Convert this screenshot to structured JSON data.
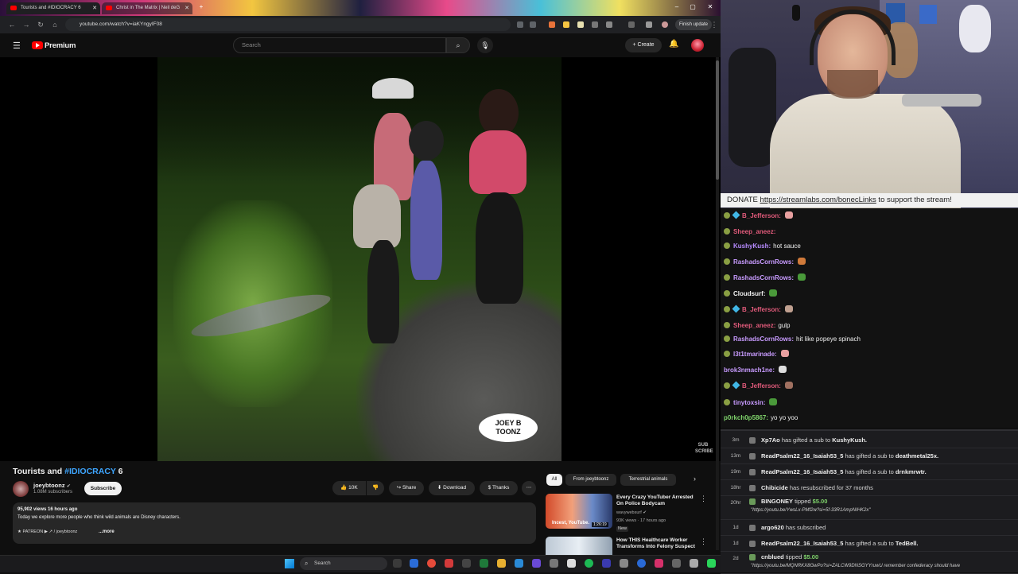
{
  "browser": {
    "tabs": [
      {
        "label": "Tourists and #IDIOCRACY 6"
      },
      {
        "label": "Christ in The Matrix | Neil deG"
      }
    ],
    "url": "youtube.com/watch?v=iaKYngyIF08",
    "finish_update": "Finish update"
  },
  "youtube": {
    "logo_text": "Premium",
    "search_placeholder": "Search",
    "create_label": "Create",
    "video": {
      "title_prefix": "Tourists and ",
      "title_tag": "#IDIOCRACY",
      "title_suffix": " 6",
      "watermark_line1": "JOEY B",
      "watermark_line2": "TOONZ",
      "corner_mark_line1": "SUB",
      "corner_mark_line2": "SCRIBE"
    },
    "channel": {
      "name": "joeybtoonz",
      "subs": "1.08M subscribers",
      "subscribe_label": "Subscribe"
    },
    "actions": {
      "likes": "10K",
      "share": "Share",
      "download": "Download",
      "thanks": "Thanks",
      "more": "⋯"
    },
    "description": {
      "stats": "95,902 views  16 hours ago",
      "text": "Today we explore more people who think wild animals are Disney characters.",
      "patreon": "★ PATREON ▶ ↗ / joeybtoonz",
      "more_label": "...more"
    },
    "chips": [
      "All",
      "From joeybtoonz",
      "Terrestrial animals"
    ],
    "recommendations": [
      {
        "title": "Every Crazy YouTuber Arrested On Police Bodycam",
        "channel": "wavywebsurf",
        "meta": "93K views · 17 hours ago",
        "badge": "New",
        "thumb_text": "Incest, YouTube.",
        "duration": "1:26:19"
      },
      {
        "title": "How THIS Healthcare Worker Transforms Into Felony Suspect",
        "channel": "",
        "meta": "",
        "badge": "",
        "thumb_text": "",
        "duration": ""
      }
    ]
  },
  "stream": {
    "donate_prefix": "DONATE ",
    "donate_link": "https://streamlabs.com/bonecLinks",
    "donate_suffix": " to support the stream!",
    "chat": [
      {
        "user": "B_Jefferson:",
        "color": "#e05a7a",
        "msg": "",
        "badge": "diamond",
        "emote": "#e8a0a0"
      },
      {
        "user": "Sheep_aneez:",
        "color": "#e05a7a",
        "msg": "",
        "badge": "circle",
        "emote": ""
      },
      {
        "user": "KushyKush:",
        "color": "#b78bff",
        "msg": "hot sauce",
        "badge": "circle",
        "emote": ""
      },
      {
        "user": "RashadsCornRows:",
        "color": "#c89bff",
        "msg": "",
        "badge": "circle",
        "emote": "#d07a3a"
      },
      {
        "user": "RashadsCornRows:",
        "color": "#c89bff",
        "msg": "",
        "badge": "circle",
        "emote": "#4a9a3a"
      },
      {
        "user": "Cloudsurf:",
        "color": "#f1f1f1",
        "msg": "",
        "badge": "circle",
        "emote": "#4a9a3a"
      },
      {
        "user": "B_Jefferson:",
        "color": "#e05a7a",
        "msg": "",
        "badge": "diamond",
        "emote": "#c0a090"
      },
      {
        "user": "Sheep_aneez:",
        "color": "#e05a7a",
        "msg": "gulp",
        "badge": "circle",
        "emote": ""
      },
      {
        "user": "RashadsCornRows:",
        "color": "#c89bff",
        "msg": "hit like popeye spinach",
        "badge": "circle",
        "emote": ""
      },
      {
        "user": "l3t1tmarinade:",
        "color": "#c89bff",
        "msg": "",
        "badge": "circle",
        "emote": "#e8a0a0"
      },
      {
        "user": "brok3nmach1ne:",
        "color": "#c89bff",
        "msg": "",
        "badge": "none",
        "emote": "#dddddd"
      },
      {
        "user": "B_Jefferson:",
        "color": "#e05a7a",
        "msg": "",
        "badge": "diamond",
        "emote": "#a07060"
      },
      {
        "user": "tinytoxsin:",
        "color": "#c89bff",
        "msg": "",
        "badge": "circle",
        "emote": "#4a9a3a"
      },
      {
        "user": "p0rkch0p5867:",
        "color": "#7fd36b",
        "msg": "yo yo yoo",
        "badge": "none",
        "emote": ""
      }
    ],
    "events": [
      {
        "time": "3m",
        "text_a": "Xp7Ao",
        "text_b": " has gifted a sub to ",
        "text_c": "KushyKush.",
        "link": ""
      },
      {
        "time": "13m",
        "text_a": "ReadPsalm22_16_Isaiah53_5",
        "text_b": " has gifted a sub to ",
        "text_c": "deathmetal25x.",
        "link": ""
      },
      {
        "time": "19m",
        "text_a": "ReadPsalm22_16_Isaiah53_5",
        "text_b": " has gifted a sub to ",
        "text_c": "drnkmrwtr.",
        "link": ""
      },
      {
        "time": "18hr",
        "text_a": "Chibicide",
        "text_b": " has resubscribed for 37 months",
        "text_c": "",
        "link": ""
      },
      {
        "time": "20hr",
        "text_a": "BINGONEY",
        "text_b": " tipped ",
        "text_c": "$5.00",
        "link": "\"https://youtu.be/YwsLx-PMf2w?si=5f-33R1AmpNIHK2x\""
      },
      {
        "time": "1d",
        "text_a": "argo620",
        "text_b": " has subscribed",
        "text_c": "",
        "link": ""
      },
      {
        "time": "1d",
        "text_a": "ReadPsalm22_16_Isaiah53_5",
        "text_b": " has gifted a sub to ",
        "text_c": "TedBell.",
        "link": ""
      },
      {
        "time": "2d",
        "text_a": "cnblued",
        "text_b": " tipped ",
        "text_c": "$5.00",
        "link": "\"https://youtu.be/MQNRKX8GwPo?si=ZALCW9DNSGYYruwU remember confederacy should have"
      }
    ]
  },
  "taskbar": {
    "search_placeholder": "Search"
  },
  "colors": {
    "yt_red": "#ff0000",
    "link_blue": "#3ea6ff",
    "tip_green": "#7fd36b"
  }
}
